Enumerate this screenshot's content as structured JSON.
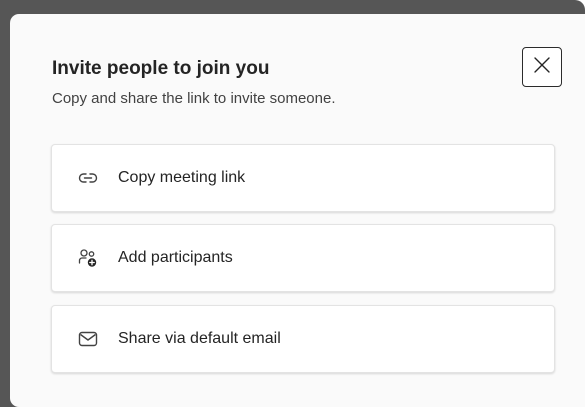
{
  "dialog": {
    "title": "Invite people to join you",
    "subtitle": "Copy and share the link to invite someone.",
    "close_icon": "close-icon"
  },
  "options": [
    {
      "label": "Copy meeting link",
      "icon": "link-icon"
    },
    {
      "label": "Add participants",
      "icon": "add-people-icon"
    },
    {
      "label": "Share via default email",
      "icon": "mail-icon"
    }
  ],
  "colors": {
    "backdrop": "#565656",
    "dialog_bg": "#fafafa",
    "card_bg": "#ffffff",
    "text": "#242424"
  }
}
